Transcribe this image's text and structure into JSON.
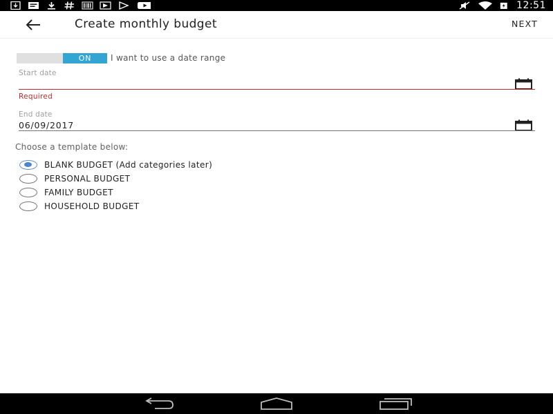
{
  "status_bar": {
    "time": "12:51",
    "icons": [
      "download-icon",
      "message-icon",
      "download-arrow-icon",
      "hashtag-icon",
      "barcode-icon",
      "play-store-icon",
      "play-icon",
      "youtube-icon",
      "mute-icon",
      "wifi-icon",
      "battery-charging-icon"
    ]
  },
  "app_bar": {
    "title": "Create monthly budget",
    "next_label": "NEXT"
  },
  "date_range": {
    "toggle_state": "ON",
    "toggle_label": "I want to use a date range",
    "start_date": {
      "label": "Start date",
      "value": "",
      "error": "Required"
    },
    "end_date": {
      "label": "End date",
      "value": "06/09/2017"
    }
  },
  "templates": {
    "heading": "Choose a template below:",
    "options": [
      {
        "label": "BLANK BUDGET (Add categories later)",
        "selected": true
      },
      {
        "label": "PERSONAL BUDGET",
        "selected": false
      },
      {
        "label": "FAMILY BUDGET",
        "selected": false
      },
      {
        "label": "HOUSEHOLD BUDGET",
        "selected": false
      }
    ]
  },
  "colors": {
    "accent": "#33a5d5",
    "error": "#c62828",
    "radio_selected": "#4a86d0"
  }
}
